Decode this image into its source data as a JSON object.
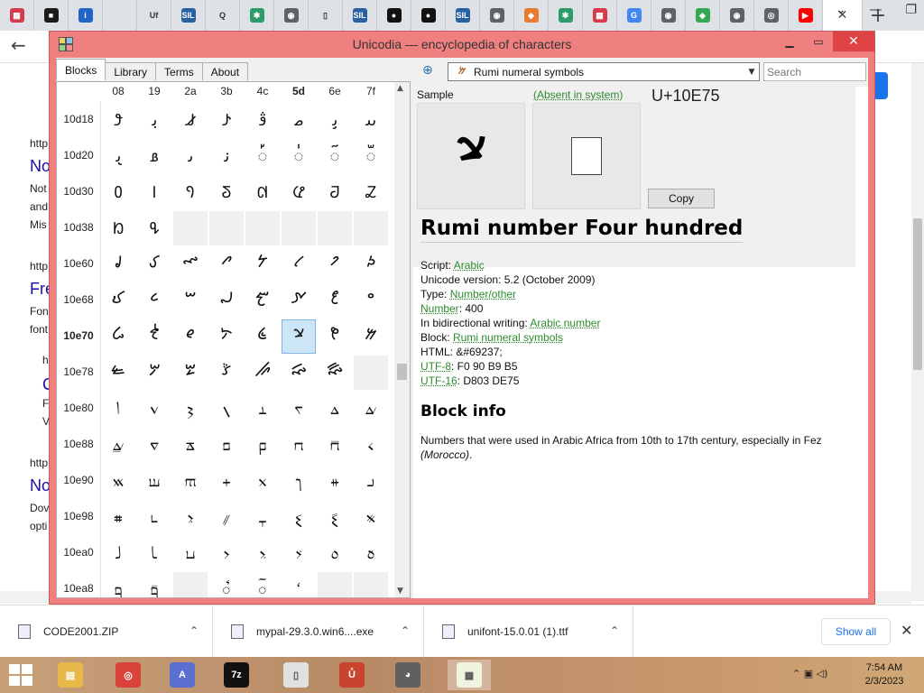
{
  "browser": {
    "tabs": [
      {
        "icon": "grid-icon",
        "color": "#d63b4b",
        "glyph": "▦"
      },
      {
        "icon": "dark-square-icon",
        "color": "#1b1b1b",
        "glyph": "■"
      },
      {
        "icon": "info-icon",
        "color": "#2163c7",
        "glyph": "i"
      },
      {
        "icon": "blank-icon",
        "color": "#dee1e6",
        "glyph": ""
      },
      {
        "icon": "uf-icon",
        "color": "#dee1e6",
        "glyph": "Uf"
      },
      {
        "icon": "sil-icon",
        "color": "#2a5fa0",
        "glyph": "SIL"
      },
      {
        "icon": "q-icon",
        "color": "#dee1e6",
        "glyph": "Q"
      },
      {
        "icon": "puzzle-icon",
        "color": "#2e9c6a",
        "glyph": "✱"
      },
      {
        "icon": "globe-icon",
        "color": "#5f6368",
        "glyph": "◉"
      },
      {
        "icon": "page-icon",
        "color": "#dee1e6",
        "glyph": "▯"
      },
      {
        "icon": "sil-icon",
        "color": "#2a5fa0",
        "glyph": "SIL"
      },
      {
        "icon": "dark-circle-icon",
        "color": "#111111",
        "glyph": "●"
      },
      {
        "icon": "dark-circle-icon",
        "color": "#111111",
        "glyph": "●"
      },
      {
        "icon": "sil-icon",
        "color": "#2a5fa0",
        "glyph": "SIL"
      },
      {
        "icon": "globe-icon",
        "color": "#5f6368",
        "glyph": "◉"
      },
      {
        "icon": "diamond-icon",
        "color": "#e87b2e",
        "glyph": "◆"
      },
      {
        "icon": "puzzle-icon",
        "color": "#2e9c6a",
        "glyph": "✱"
      },
      {
        "icon": "grid-icon",
        "color": "#d63b4b",
        "glyph": "▦"
      },
      {
        "icon": "google-icon",
        "color": "#4285f4",
        "glyph": "G"
      },
      {
        "icon": "globe-icon",
        "color": "#5f6368",
        "glyph": "◉"
      },
      {
        "icon": "maps-icon",
        "color": "#34a853",
        "glyph": "◈"
      },
      {
        "icon": "globe-icon",
        "color": "#5f6368",
        "glyph": "◉"
      },
      {
        "icon": "chrome-icon",
        "color": "#5f6368",
        "glyph": "◎"
      },
      {
        "icon": "youtube-icon",
        "color": "#ff0000",
        "glyph": "▶"
      }
    ],
    "active_tab_close": "✕",
    "new_tab": "+",
    "bg_snippets": [
      "http",
      "No",
      "Not",
      "and",
      "Mis",
      "http",
      "Fre",
      "Fon",
      "font",
      "h",
      "C",
      "F",
      "V",
      "http",
      "No",
      "Dov",
      "opti"
    ]
  },
  "app": {
    "title": "Unicodia — encyclopedia of characters",
    "colors": {
      "frame": "#f08080",
      "link": "#2e8b2e",
      "selected": "#cde6f7"
    },
    "tabs": [
      "Blocks",
      "Library",
      "Terms",
      "About"
    ],
    "grid": {
      "columns": [
        "08",
        "19",
        "2a",
        "3b",
        "4c",
        "5d",
        "6e",
        "7f"
      ],
      "bold_column": 5,
      "rows": [
        {
          "label": "10d18",
          "cells": [
            "𐴘",
            "𐴙",
            "𐴚",
            "𐴛",
            "𐴜",
            "𐴝",
            "𐴞",
            "𐴟"
          ]
        },
        {
          "label": "10d20",
          "cells": [
            "𐴠",
            "𐴡",
            "𐴢",
            "𐴣",
            "𐴤",
            "𐴥",
            "𐴦",
            "𐴧"
          ]
        },
        {
          "label": "10d30",
          "cells": [
            "𐴰",
            "𐴱",
            "𐴲",
            "𐴳",
            "𐴴",
            "𐴵",
            "𐴶",
            "𐴷"
          ]
        },
        {
          "label": "10d38",
          "cells": [
            "𐴸",
            "𐴹",
            "",
            "",
            "",
            "",
            "",
            ""
          ]
        },
        {
          "label": "10e60",
          "cells": [
            "𐹠",
            "𐹡",
            "𐹢",
            "𐹣",
            "𐹤",
            "𐹥",
            "𐹦",
            "𐹧"
          ]
        },
        {
          "label": "10e68",
          "cells": [
            "𐹨",
            "𐹩",
            "𐹪",
            "𐹫",
            "𐹬",
            "𐹭",
            "𐹮",
            "𐹯"
          ]
        },
        {
          "label": "10e70",
          "cells": [
            "𐹰",
            "𐹱",
            "𐹲",
            "𐹳",
            "𐹴",
            "𐹵",
            "𐹶",
            "𐹷"
          ]
        },
        {
          "label": "10e78",
          "cells": [
            "𐹸",
            "𐹹",
            "𐹺",
            "𐹻",
            "𐹼",
            "𐹽",
            "𐹾",
            ""
          ]
        },
        {
          "label": "10e80",
          "cells": [
            "𐺀",
            "𐺁",
            "𐺂",
            "𐺃",
            "𐺄",
            "𐺅",
            "𐺆",
            "𐺇"
          ]
        },
        {
          "label": "10e88",
          "cells": [
            "𐺈",
            "𐺉",
            "𐺊",
            "𐺋",
            "𐺌",
            "𐺍",
            "𐺎",
            "𐺏"
          ]
        },
        {
          "label": "10e90",
          "cells": [
            "𐺐",
            "𐺑",
            "𐺒",
            "𐺓",
            "𐺔",
            "𐺕",
            "𐺖",
            "𐺗"
          ]
        },
        {
          "label": "10e98",
          "cells": [
            "𐺘",
            "𐺙",
            "𐺚",
            "𐺛",
            "𐺜",
            "𐺝",
            "𐺞",
            "𐺟"
          ]
        },
        {
          "label": "10ea0",
          "cells": [
            "𐺠",
            "𐺡",
            "𐺢",
            "𐺣",
            "𐺤",
            "𐺥",
            "𐺦",
            "𐺧"
          ]
        },
        {
          "label": "10ea8",
          "cells": [
            "𐺨",
            "𐺩",
            "",
            "𐺫",
            "𐺬",
            "𐺭",
            "",
            ""
          ]
        }
      ],
      "bold_row": 6,
      "selected": {
        "row": 6,
        "col": 5
      }
    },
    "block_combo": {
      "glyph": "𐹷",
      "label": "Rumi numeral symbols"
    },
    "search_placeholder": "Search",
    "sample_label": "Sample",
    "absent_label": "(Absent in system)",
    "sample_glyph": "𐹵",
    "codepoint": "U+10E75",
    "copy_label": "Copy",
    "char_name": "Rumi number Four hundred",
    "props": {
      "script_label": "Script: ",
      "script_value": "Arabic",
      "version": "Unicode version: 5.2 (October 2009)",
      "type_label": "Type: ",
      "type_value": "Number/other",
      "number_link": "Number",
      "number_value": ": 400",
      "bidi_label": "In bidirectional writing: ",
      "bidi_value": "Arabic number",
      "block_label": "Block: ",
      "block_value": "Rumi numeral symbols",
      "html": "HTML: &#69237;",
      "utf8_link": "UTF-8",
      "utf8_value": ": F0 90 B9 B5",
      "utf16_link": "UTF-16",
      "utf16_value": ": D803 DE75"
    },
    "block_info_title": "Block info",
    "block_desc_main": "Numbers that were used in Arabic Africa from 10th to 17th century, especially in Fez ",
    "block_desc_italic": "(Morocco)",
    "block_desc_end": "."
  },
  "downloads": {
    "items": [
      {
        "name": "CODE2001.ZIP",
        "icon": "zip-file-icon"
      },
      {
        "name": "mypal-29.3.0.win6....exe",
        "icon": "exe-file-icon"
      },
      {
        "name": "unifont-15.0.01 (1).ttf",
        "icon": "font-file-icon"
      }
    ],
    "show_all": "Show all",
    "close": "✕"
  },
  "taskbar": {
    "apps": [
      {
        "name": "file-explorer-icon",
        "color": "#e8b84a",
        "label": "▤"
      },
      {
        "name": "chrome-icon",
        "color": "#d9443a",
        "label": "◎"
      },
      {
        "name": "app-a-icon",
        "color": "#5a6fd0",
        "label": "A"
      },
      {
        "name": "7zip-icon",
        "color": "#111111",
        "label": "7z"
      },
      {
        "name": "notepad-icon",
        "color": "#e0e0e0",
        "label": "▯"
      },
      {
        "name": "red-app-icon",
        "color": "#c8442e",
        "label": "Ů"
      },
      {
        "name": "raccoon-icon",
        "color": "#606060",
        "label": "◕"
      },
      {
        "name": "unicodia-icon",
        "color": "#f2f2e0",
        "label": "▦"
      }
    ],
    "time": "7:54 AM",
    "date": "2/3/2023"
  }
}
